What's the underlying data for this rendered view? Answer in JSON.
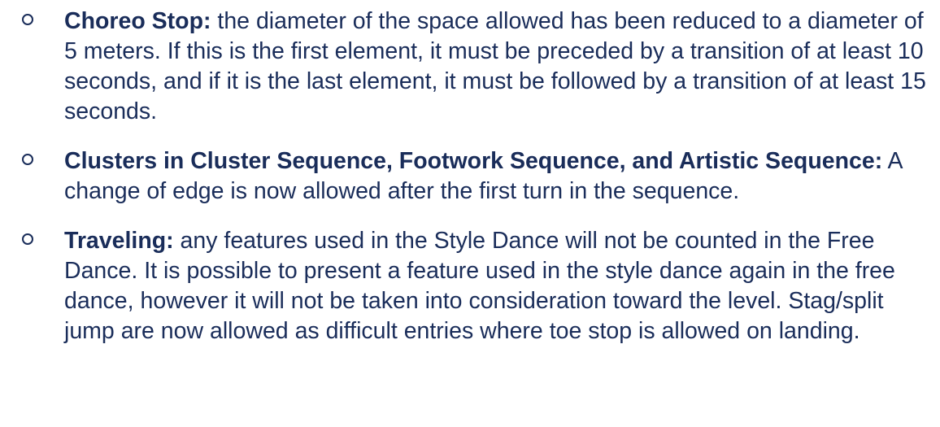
{
  "items": [
    {
      "term": "Choreo Stop:",
      "text": " the diameter of the space allowed has been reduced to a diameter of 5 meters. If this is the first element, it must be preceded by a transition of at least 10 seconds, and if it is the last element, it must be followed by a transition of at least 15 seconds."
    },
    {
      "term": "Clusters in Cluster Sequence, Footwork Sequence, and Artistic Sequence:",
      "text": " A change of edge is now allowed after the first turn in the sequence."
    },
    {
      "term": "Traveling:",
      "text": " any features used in the Style Dance will not be counted in the Free Dance. It is possible to present a feature used in the style dance again in the free dance, however it will not be taken into consideration toward the level. Stag/split jump are now allowed as difficult entries where toe stop is allowed on landing."
    }
  ]
}
